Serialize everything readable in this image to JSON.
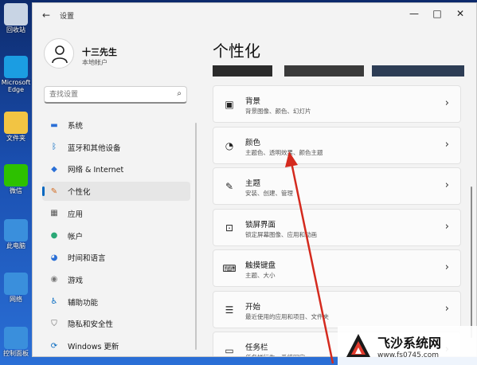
{
  "desktop": {
    "icons": [
      {
        "label": "回收站",
        "color": "#c8d4e4"
      },
      {
        "label": "Microsoft Edge",
        "color": "#1b9de2"
      },
      {
        "label": "文件夹",
        "color": "#f2c443"
      },
      {
        "label": "微信",
        "color": "#2dc100"
      },
      {
        "label": "此电脑",
        "color": "#3a8fdc"
      },
      {
        "label": "网络",
        "color": "#3a8fdc"
      },
      {
        "label": "控制面板",
        "color": "#3a8fdc"
      }
    ]
  },
  "window": {
    "title": "设置",
    "controls": {
      "minimize": "—",
      "maximize": "□",
      "close": "✕"
    },
    "back": "←"
  },
  "profile": {
    "name": "十三先生",
    "account": "本地帐户"
  },
  "search": {
    "placeholder": "查找设置",
    "icon": "search-icon"
  },
  "nav": {
    "items": [
      {
        "label": "系统",
        "icon": "monitor-icon",
        "glyph": "▬",
        "color": "#2a6fd6"
      },
      {
        "label": "蓝牙和其他设备",
        "icon": "bluetooth-icon",
        "glyph": "ᛒ",
        "color": "#0067c0"
      },
      {
        "label": "网络 & Internet",
        "icon": "wifi-icon",
        "glyph": "◆",
        "color": "#2a6fd6"
      },
      {
        "label": "个性化",
        "icon": "brush-icon",
        "glyph": "✎",
        "color": "#d46a1e"
      },
      {
        "label": "应用",
        "icon": "apps-icon",
        "glyph": "▦",
        "color": "#555555"
      },
      {
        "label": "帐户",
        "icon": "account-icon",
        "glyph": "●",
        "color": "#2aa876"
      },
      {
        "label": "时间和语言",
        "icon": "globe-icon",
        "glyph": "◕",
        "color": "#2a6fd6"
      },
      {
        "label": "游戏",
        "icon": "game-icon",
        "glyph": "◉",
        "color": "#777777"
      },
      {
        "label": "辅助功能",
        "icon": "accessibility-icon",
        "glyph": "♿",
        "color": "#0067c0"
      },
      {
        "label": "隐私和安全性",
        "icon": "shield-icon",
        "glyph": "⛉",
        "color": "#666666"
      },
      {
        "label": "Windows 更新",
        "icon": "update-icon",
        "glyph": "⟳",
        "color": "#0067c0"
      }
    ],
    "active_index": 3
  },
  "main": {
    "title": "个性化",
    "cards": [
      {
        "title": "背景",
        "sub": "背景图像、颜色、幻灯片",
        "icon": "image-icon",
        "glyph": "▣"
      },
      {
        "title": "颜色",
        "sub": "主题色、透明效果、颜色主题",
        "icon": "palette-icon",
        "glyph": "◔"
      },
      {
        "title": "主题",
        "sub": "安装、创建、管理",
        "icon": "brush-icon",
        "glyph": "✎"
      },
      {
        "title": "锁屏界面",
        "sub": "锁定屏幕图像、应用和动画",
        "icon": "lockscreen-icon",
        "glyph": "⊡"
      },
      {
        "title": "触摸键盘",
        "sub": "主题、大小",
        "icon": "keyboard-icon",
        "glyph": "⌨"
      },
      {
        "title": "开始",
        "sub": "最近使用的应用和项目、文件夹",
        "icon": "start-icon",
        "glyph": "☰"
      },
      {
        "title": "任务栏",
        "sub": "任务栏行为、系统固定",
        "icon": "taskbar-icon",
        "glyph": "▭"
      }
    ],
    "chevron": "›"
  },
  "watermark": {
    "brand": "飞沙系统网",
    "url": "www.fs0745.com"
  },
  "colors": {
    "accent": "#0067c0",
    "annotation_arrow": "#d42a1e"
  }
}
